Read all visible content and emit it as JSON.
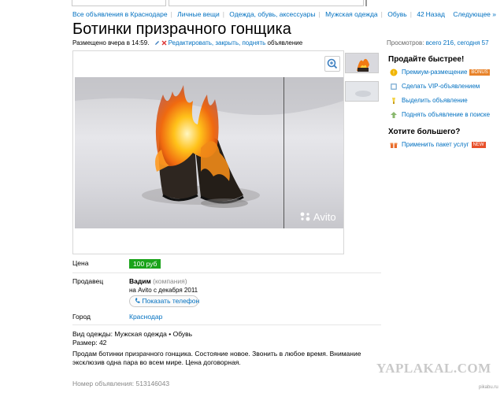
{
  "breadcrumbs": [
    "Все объявления в Краснодаре",
    "Личные вещи",
    "Одежда, обувь, аксессуары",
    "Мужская одежда",
    "Обувь",
    "42"
  ],
  "nav": {
    "back": "Назад",
    "next": "Следующее »"
  },
  "listing": {
    "title": "Ботинки призрачного гонщика",
    "posted": "Размещено вчера в 14:59.",
    "edit_link": "Редактировать, закрыть, поднять",
    "edit_suffix": "объявление",
    "views_label": "Просмотров:",
    "views_value": "всего 216, сегодня 57"
  },
  "gallery": {
    "watermark": "Avito",
    "zoom_icon": "zoom-in-icon",
    "thumb_count": 2
  },
  "details": {
    "price_label": "Цена",
    "price_value": "100 руб",
    "seller_label": "Продавец",
    "seller_name": "Вадим",
    "seller_type": "(компания)",
    "seller_since": "на Avito с декабря 2011",
    "phone_button": "Показать телефон",
    "city_label": "Город",
    "city_value": "Краснодар",
    "param_type": "Вид одежды: Мужская одежда • Обувь",
    "param_size": "Размер: 42",
    "description": "Продам ботинки призрачного гонщика. Состояние новое. Звонить в любое время. Внимание эксклюзив одна пара во всем мире. Цена договорная.",
    "ad_number": "Номер объявления: 513146043"
  },
  "sidebar": {
    "sell_title": "Продайте быстрее!",
    "items": [
      {
        "label": "Премиум-размещение",
        "badge": "BONUS",
        "badge_color": "#e8832a",
        "icon": "premium-icon",
        "icon_color": "#f0b400"
      },
      {
        "label": "Сделать VIP-объявлением",
        "badge": "",
        "icon": "vip-icon",
        "icon_color": "#8db7d8"
      },
      {
        "label": "Выделить объявление",
        "badge": "",
        "icon": "highlight-icon",
        "icon_color": "#f3d34a"
      },
      {
        "label": "Поднять объявление в поиске",
        "badge": "",
        "icon": "up-arrow-icon",
        "icon_color": "#8ab86e"
      }
    ],
    "more_title": "Хотите большего?",
    "package": {
      "label": "Применить пакет услуг",
      "badge": "NEW",
      "badge_color": "#e8502a",
      "icon": "gift-icon",
      "icon_color": "#e86a2a"
    }
  },
  "watermarks": {
    "yaplakal": "YAPLAKAL.COM",
    "pikabu": "pikabu.ru"
  },
  "colors": {
    "link": "#0070c0",
    "price_bg": "#1aa31a"
  }
}
